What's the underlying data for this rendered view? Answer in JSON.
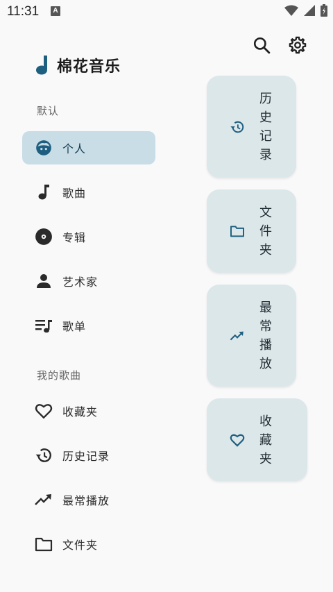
{
  "status": {
    "time": "11:31",
    "indicator": "A"
  },
  "app": {
    "title": "棉花音乐"
  },
  "sections": {
    "default_label": "默认",
    "mine_label": "我的歌曲"
  },
  "nav": {
    "personal": "个人",
    "songs": "歌曲",
    "albums": "专辑",
    "artists": "艺术家",
    "playlists": "歌单",
    "favorites": "收藏夹",
    "history": "历史记录",
    "most_played": "最常播放",
    "folders": "文件夹"
  },
  "cards": {
    "history": [
      "历",
      "史",
      "记",
      "录"
    ],
    "folders": [
      "文",
      "件",
      "夹"
    ],
    "most_played": [
      "最",
      "常",
      "播",
      "放"
    ],
    "favorites": [
      "收",
      "藏",
      "夹"
    ]
  },
  "icons": {
    "search": "search-icon",
    "settings": "gear-icon",
    "logo": "music-note-icon"
  },
  "colors": {
    "accent": "#1e5f80",
    "active_bg": "#c9dde6",
    "card_bg": "#dce7ea"
  }
}
